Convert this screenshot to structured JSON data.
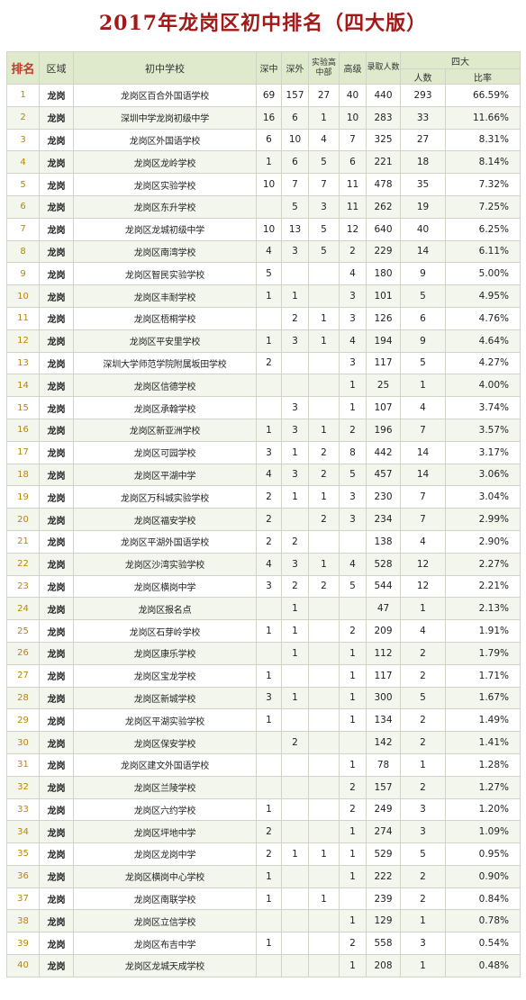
{
  "title": "2017年龙岗区初中排名（四大版）",
  "headers": {
    "rank": "排名",
    "region": "区域",
    "school": "初中学校",
    "shenzhong": "深中",
    "shenwai": "深外",
    "shiyan": "实验高中部",
    "gaoji": "高级",
    "luqu": "录取人数",
    "sida": "四大",
    "sida_count": "人数",
    "sida_ratio": "比率"
  },
  "rows": [
    {
      "rank": "1",
      "region": "龙岗",
      "school": "龙岗区百合外国语学校",
      "shenzhong": "69",
      "shenwai": "157",
      "shiyan": "27",
      "gaoji": "40",
      "luqu": "440",
      "count": "293",
      "ratio": "66.59%"
    },
    {
      "rank": "2",
      "region": "龙岗",
      "school": "深圳中学龙岗初级中学",
      "shenzhong": "16",
      "shenwai": "6",
      "shiyan": "1",
      "gaoji": "10",
      "luqu": "283",
      "count": "33",
      "ratio": "11.66%"
    },
    {
      "rank": "3",
      "region": "龙岗",
      "school": "龙岗区外国语学校",
      "shenzhong": "6",
      "shenwai": "10",
      "shiyan": "4",
      "gaoji": "7",
      "luqu": "325",
      "count": "27",
      "ratio": "8.31%"
    },
    {
      "rank": "4",
      "region": "龙岗",
      "school": "龙岗区龙岭学校",
      "shenzhong": "1",
      "shenwai": "6",
      "shiyan": "5",
      "gaoji": "6",
      "luqu": "221",
      "count": "18",
      "ratio": "8.14%"
    },
    {
      "rank": "5",
      "region": "龙岗",
      "school": "龙岗区实验学校",
      "shenzhong": "10",
      "shenwai": "7",
      "shiyan": "7",
      "gaoji": "11",
      "luqu": "478",
      "count": "35",
      "ratio": "7.32%"
    },
    {
      "rank": "6",
      "region": "龙岗",
      "school": "龙岗区东升学校",
      "shenzhong": "",
      "shenwai": "5",
      "shiyan": "3",
      "gaoji": "11",
      "luqu": "262",
      "count": "19",
      "ratio": "7.25%"
    },
    {
      "rank": "7",
      "region": "龙岗",
      "school": "龙岗区龙城初级中学",
      "shenzhong": "10",
      "shenwai": "13",
      "shiyan": "5",
      "gaoji": "12",
      "luqu": "640",
      "count": "40",
      "ratio": "6.25%"
    },
    {
      "rank": "8",
      "region": "龙岗",
      "school": "龙岗区南湾学校",
      "shenzhong": "4",
      "shenwai": "3",
      "shiyan": "5",
      "gaoji": "2",
      "luqu": "229",
      "count": "14",
      "ratio": "6.11%"
    },
    {
      "rank": "9",
      "region": "龙岗",
      "school": "龙岗区智民实验学校",
      "shenzhong": "5",
      "shenwai": "",
      "shiyan": "",
      "gaoji": "4",
      "luqu": "180",
      "count": "9",
      "ratio": "5.00%"
    },
    {
      "rank": "10",
      "region": "龙岗",
      "school": "龙岗区丰耐学校",
      "shenzhong": "1",
      "shenwai": "1",
      "shiyan": "",
      "gaoji": "3",
      "luqu": "101",
      "count": "5",
      "ratio": "4.95%"
    },
    {
      "rank": "11",
      "region": "龙岗",
      "school": "龙岗区梧桐学校",
      "shenzhong": "",
      "shenwai": "2",
      "shiyan": "1",
      "gaoji": "3",
      "luqu": "126",
      "count": "6",
      "ratio": "4.76%"
    },
    {
      "rank": "12",
      "region": "龙岗",
      "school": "龙岗区平安里学校",
      "shenzhong": "1",
      "shenwai": "3",
      "shiyan": "1",
      "gaoji": "4",
      "luqu": "194",
      "count": "9",
      "ratio": "4.64%"
    },
    {
      "rank": "13",
      "region": "龙岗",
      "school": "深圳大学师范学院附属坂田学校",
      "shenzhong": "2",
      "shenwai": "",
      "shiyan": "",
      "gaoji": "3",
      "luqu": "117",
      "count": "5",
      "ratio": "4.27%"
    },
    {
      "rank": "14",
      "region": "龙岗",
      "school": "龙岗区信德学校",
      "shenzhong": "",
      "shenwai": "",
      "shiyan": "",
      "gaoji": "1",
      "luqu": "25",
      "count": "1",
      "ratio": "4.00%"
    },
    {
      "rank": "15",
      "region": "龙岗",
      "school": "龙岗区承翰学校",
      "shenzhong": "",
      "shenwai": "3",
      "shiyan": "",
      "gaoji": "1",
      "luqu": "107",
      "count": "4",
      "ratio": "3.74%"
    },
    {
      "rank": "16",
      "region": "龙岗",
      "school": "龙岗区新亚洲学校",
      "shenzhong": "1",
      "shenwai": "3",
      "shiyan": "1",
      "gaoji": "2",
      "luqu": "196",
      "count": "7",
      "ratio": "3.57%"
    },
    {
      "rank": "17",
      "region": "龙岗",
      "school": "龙岗区可园学校",
      "shenzhong": "3",
      "shenwai": "1",
      "shiyan": "2",
      "gaoji": "8",
      "luqu": "442",
      "count": "14",
      "ratio": "3.17%"
    },
    {
      "rank": "18",
      "region": "龙岗",
      "school": "龙岗区平湖中学",
      "shenzhong": "4",
      "shenwai": "3",
      "shiyan": "2",
      "gaoji": "5",
      "luqu": "457",
      "count": "14",
      "ratio": "3.06%"
    },
    {
      "rank": "19",
      "region": "龙岗",
      "school": "龙岗区万科城实验学校",
      "shenzhong": "2",
      "shenwai": "1",
      "shiyan": "1",
      "gaoji": "3",
      "luqu": "230",
      "count": "7",
      "ratio": "3.04%"
    },
    {
      "rank": "20",
      "region": "龙岗",
      "school": "龙岗区福安学校",
      "shenzhong": "2",
      "shenwai": "",
      "shiyan": "2",
      "gaoji": "3",
      "luqu": "234",
      "count": "7",
      "ratio": "2.99%"
    },
    {
      "rank": "21",
      "region": "龙岗",
      "school": "龙岗区平湖外国语学校",
      "shenzhong": "2",
      "shenwai": "2",
      "shiyan": "",
      "gaoji": "",
      "luqu": "138",
      "count": "4",
      "ratio": "2.90%"
    },
    {
      "rank": "22",
      "region": "龙岗",
      "school": "龙岗区沙湾实验学校",
      "shenzhong": "4",
      "shenwai": "3",
      "shiyan": "1",
      "gaoji": "4",
      "luqu": "528",
      "count": "12",
      "ratio": "2.27%"
    },
    {
      "rank": "23",
      "region": "龙岗",
      "school": "龙岗区横岗中学",
      "shenzhong": "3",
      "shenwai": "2",
      "shiyan": "2",
      "gaoji": "5",
      "luqu": "544",
      "count": "12",
      "ratio": "2.21%"
    },
    {
      "rank": "24",
      "region": "龙岗",
      "school": "龙岗区报名点",
      "shenzhong": "",
      "shenwai": "1",
      "shiyan": "",
      "gaoji": "",
      "luqu": "47",
      "count": "1",
      "ratio": "2.13%"
    },
    {
      "rank": "25",
      "region": "龙岗",
      "school": "龙岗区石芽岭学校",
      "shenzhong": "1",
      "shenwai": "1",
      "shiyan": "",
      "gaoji": "2",
      "luqu": "209",
      "count": "4",
      "ratio": "1.91%"
    },
    {
      "rank": "26",
      "region": "龙岗",
      "school": "龙岗区康乐学校",
      "shenzhong": "",
      "shenwai": "1",
      "shiyan": "",
      "gaoji": "1",
      "luqu": "112",
      "count": "2",
      "ratio": "1.79%"
    },
    {
      "rank": "27",
      "region": "龙岗",
      "school": "龙岗区宝龙学校",
      "shenzhong": "1",
      "shenwai": "",
      "shiyan": "",
      "gaoji": "1",
      "luqu": "117",
      "count": "2",
      "ratio": "1.71%"
    },
    {
      "rank": "28",
      "region": "龙岗",
      "school": "龙岗区新城学校",
      "shenzhong": "3",
      "shenwai": "1",
      "shiyan": "",
      "gaoji": "1",
      "luqu": "300",
      "count": "5",
      "ratio": "1.67%"
    },
    {
      "rank": "29",
      "region": "龙岗",
      "school": "龙岗区平湖实验学校",
      "shenzhong": "1",
      "shenwai": "",
      "shiyan": "",
      "gaoji": "1",
      "luqu": "134",
      "count": "2",
      "ratio": "1.49%"
    },
    {
      "rank": "30",
      "region": "龙岗",
      "school": "龙岗区保安学校",
      "shenzhong": "",
      "shenwai": "2",
      "shiyan": "",
      "gaoji": "",
      "luqu": "142",
      "count": "2",
      "ratio": "1.41%"
    },
    {
      "rank": "31",
      "region": "龙岗",
      "school": "龙岗区建文外国语学校",
      "shenzhong": "",
      "shenwai": "",
      "shiyan": "",
      "gaoji": "1",
      "luqu": "78",
      "count": "1",
      "ratio": "1.28%"
    },
    {
      "rank": "32",
      "region": "龙岗",
      "school": "龙岗区兰陵学校",
      "shenzhong": "",
      "shenwai": "",
      "shiyan": "",
      "gaoji": "2",
      "luqu": "157",
      "count": "2",
      "ratio": "1.27%"
    },
    {
      "rank": "33",
      "region": "龙岗",
      "school": "龙岗区六约学校",
      "shenzhong": "1",
      "shenwai": "",
      "shiyan": "",
      "gaoji": "2",
      "luqu": "249",
      "count": "3",
      "ratio": "1.20%"
    },
    {
      "rank": "34",
      "region": "龙岗",
      "school": "龙岗区坪地中学",
      "shenzhong": "2",
      "shenwai": "",
      "shiyan": "",
      "gaoji": "1",
      "luqu": "274",
      "count": "3",
      "ratio": "1.09%"
    },
    {
      "rank": "35",
      "region": "龙岗",
      "school": "龙岗区龙岗中学",
      "shenzhong": "2",
      "shenwai": "1",
      "shiyan": "1",
      "gaoji": "1",
      "luqu": "529",
      "count": "5",
      "ratio": "0.95%"
    },
    {
      "rank": "36",
      "region": "龙岗",
      "school": "龙岗区横岗中心学校",
      "shenzhong": "1",
      "shenwai": "",
      "shiyan": "",
      "gaoji": "1",
      "luqu": "222",
      "count": "2",
      "ratio": "0.90%"
    },
    {
      "rank": "37",
      "region": "龙岗",
      "school": "龙岗区南联学校",
      "shenzhong": "1",
      "shenwai": "",
      "shiyan": "1",
      "gaoji": "",
      "luqu": "239",
      "count": "2",
      "ratio": "0.84%"
    },
    {
      "rank": "38",
      "region": "龙岗",
      "school": "龙岗区立信学校",
      "shenzhong": "",
      "shenwai": "",
      "shiyan": "",
      "gaoji": "1",
      "luqu": "129",
      "count": "1",
      "ratio": "0.78%"
    },
    {
      "rank": "39",
      "region": "龙岗",
      "school": "龙岗区布吉中学",
      "shenzhong": "1",
      "shenwai": "",
      "shiyan": "",
      "gaoji": "2",
      "luqu": "558",
      "count": "3",
      "ratio": "0.54%"
    },
    {
      "rank": "40",
      "region": "龙岗",
      "school": "龙岗区龙城天成学校",
      "shenzhong": "",
      "shenwai": "",
      "shiyan": "",
      "gaoji": "1",
      "luqu": "208",
      "count": "1",
      "ratio": "0.48%"
    }
  ]
}
